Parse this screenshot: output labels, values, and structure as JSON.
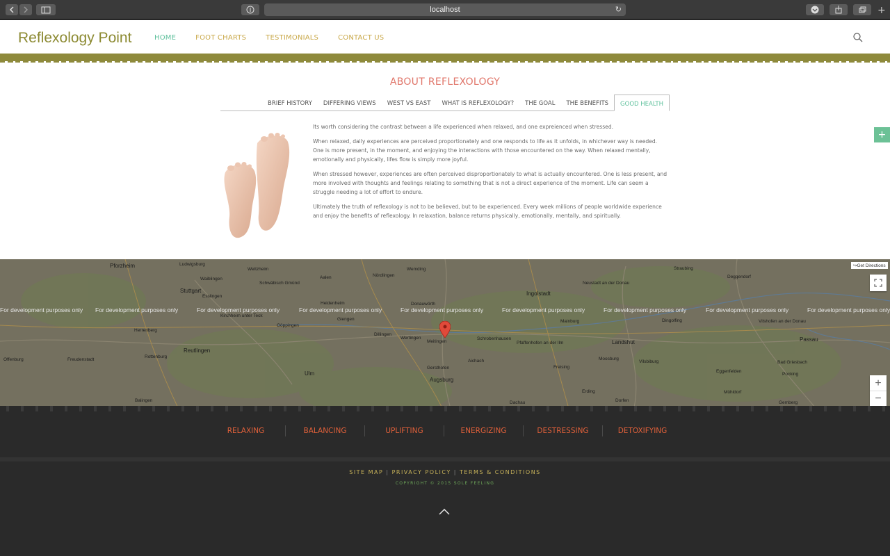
{
  "browser": {
    "url": "localhost",
    "back_icon": "chevron-left-icon",
    "forward_icon": "chevron-right-icon"
  },
  "header": {
    "logo": "Reflexology Point",
    "nav": [
      "HOME",
      "FOOT CHARTS",
      "TESTIMONIALS",
      "CONTACT US"
    ],
    "active_nav": "HOME"
  },
  "about": {
    "title": "ABOUT REFLEXOLOGY",
    "tabs": [
      "BRIEF HISTORY",
      "DIFFERING VIEWS",
      "WEST VS EAST",
      "WHAT IS REFLEXOLOGY?",
      "THE GOAL",
      "THE BENEFITS",
      "GOOD HEALTH"
    ],
    "active_tab": "GOOD HEALTH",
    "paragraphs": [
      "Its worth considering the contrast between a life experienced when relaxed, and one expreienced when stressed.",
      "When relaxed, daily experiences are perceived proportionately and one responds to life as it unfolds, in whichever way is needed. One is more present, in the moment, and enjoying the interactions with those encountered on the way. When relaxed mentally, emotionally and physically, lifes flow is simply more joyful.",
      "When stressed however, experiences are often perceived disproportionately to what is actually encountered. One is less present, and more involved with thoughts and feelings relating to something that is not a direct experience of the moment. Life can seem a struggle needing a lot of effort to endure.",
      "Ultimately the truth of reflexology is not to be believed, but to be experienced. Every week millions of people worldwide experience and enjoy the benefits of reflexology. In relaxation, balance returns physically, emotionally, mentally, and spiritually."
    ]
  },
  "map": {
    "watermark": "For development purposes only",
    "get_directions": "Get Directions",
    "zoom_in": "+",
    "zoom_out": "−",
    "cities": [
      "Pforzheim",
      "Ludwigsburg",
      "Weltzheim",
      "Stuttgart",
      "Esslingen",
      "Waiblingen",
      "Schwäbisch Gmünd",
      "Aalen",
      "Nördlingen",
      "Wemding",
      "Donauwörth",
      "Ingolstadt",
      "Neustadt an der Donau",
      "Straubing",
      "Deggendorf",
      "Kirchheim unter Teck",
      "Göppingen",
      "Heidenheim",
      "Giengen",
      "Dillingen",
      "Wertingen",
      "Meitingen",
      "Schrobenhausen",
      "Pfaffenhofen an der Ilm",
      "Mainburg",
      "Landshut",
      "Dingolfing",
      "Vilshofen an der Donau",
      "Passau",
      "Offenburg",
      "Freudenstadt",
      "Reutlingen",
      "Rottenburg",
      "Herrenberg",
      "Ulm",
      "Augsburg",
      "Gersthofen",
      "Aichach",
      "Freising",
      "Moosburg",
      "Vilsbiburg",
      "Eggenfelden",
      "Bad Griesbach",
      "Pocking",
      "Balingen",
      "Dachau",
      "Erding",
      "Dorfen",
      "Mühldorf",
      "Gemberg"
    ]
  },
  "footer": {
    "benefits": [
      "RELAXING",
      "BALANCING",
      "UPLIFTING",
      "ENERGIZING",
      "DESTRESSING",
      "DETOXIFYING"
    ],
    "links": [
      "SITE MAP",
      "PRIVACY POLICY",
      "TERMS & CONDITIONS"
    ],
    "copyright": "COPYRIGHT © 2015 SOLE FEELING"
  },
  "side_button": "+",
  "colors": {
    "logo": "#8c8a32",
    "nav": "#c9a849",
    "active": "#5ec09c",
    "title": "#e0766a",
    "benefit": "#e0603a"
  }
}
